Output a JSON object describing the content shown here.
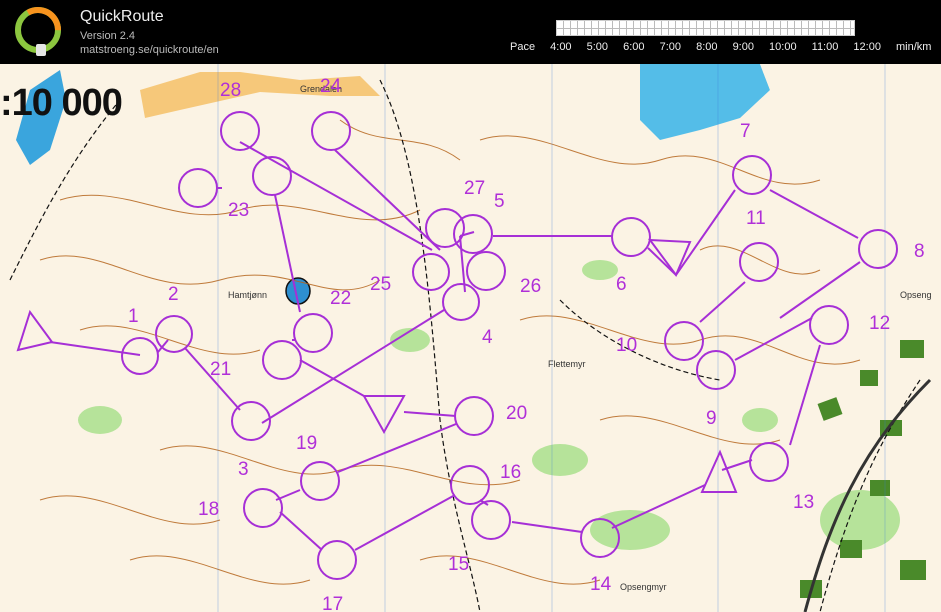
{
  "app": {
    "title": "QuickRoute",
    "version": "Version 2.4",
    "url": "matstroeng.se/quickroute/en",
    "logo_letter": "Q"
  },
  "pace": {
    "label": "Pace",
    "ticks": [
      "4:00",
      "5:00",
      "6:00",
      "7:00",
      "8:00",
      "9:00",
      "10:00",
      "11:00",
      "12:00"
    ],
    "unit": "min/km"
  },
  "map": {
    "scale_text": ":10 000",
    "place_names": [
      "Grendalen",
      "Hamtjønn",
      "Flettemyr",
      "Opseng",
      "Opsengmyr"
    ],
    "control_numbers": [
      "1",
      "2",
      "3",
      "4",
      "5",
      "6",
      "7",
      "8",
      "9",
      "10",
      "11",
      "12",
      "13",
      "14",
      "15",
      "16",
      "17",
      "18",
      "19",
      "20",
      "21",
      "22",
      "23",
      "24",
      "25",
      "26",
      "27",
      "28"
    ],
    "course_color": "#b02fd8",
    "water_color": "#4fb7e8",
    "contour_color": "#b5651d",
    "vegetation_color": "#b6e39a"
  }
}
